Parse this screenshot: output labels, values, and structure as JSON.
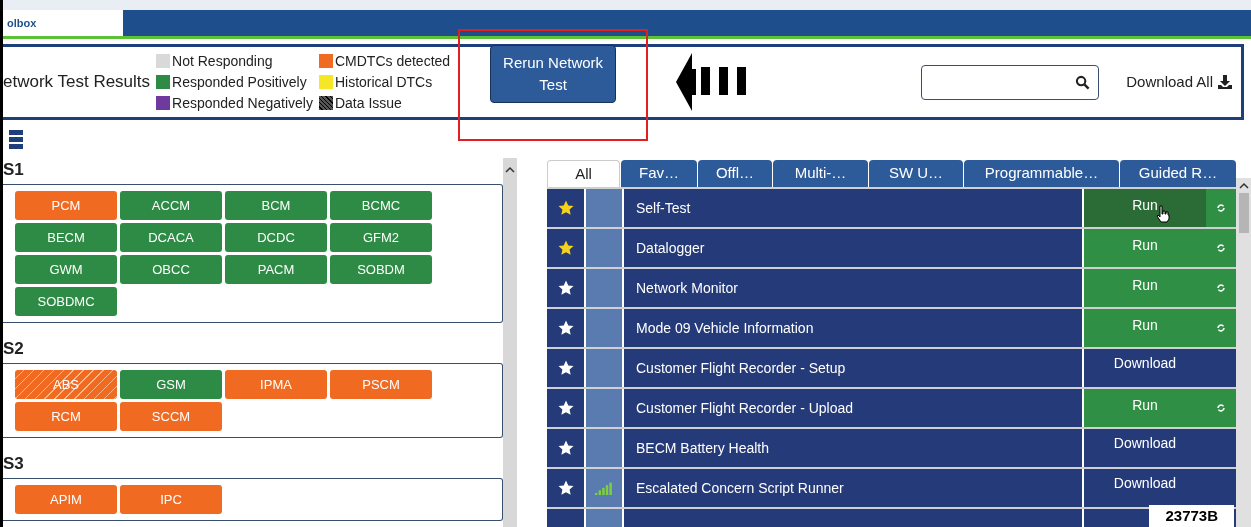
{
  "top_tab": {
    "label": "olbox",
    "selected": true
  },
  "header": {
    "title": "etwork Test Results",
    "legend": [
      {
        "label": "Not Responding",
        "color": "#d9d9d9",
        "hatched": false
      },
      {
        "label": "Responded Positively",
        "color": "#2e8b45",
        "hatched": false
      },
      {
        "label": "Responded Negatively",
        "color": "#6f3a9e",
        "hatched": false
      },
      {
        "label": "CMDTCs detected",
        "color": "#f06a22",
        "hatched": false
      },
      {
        "label": "Historical DTCs",
        "color": "#f5e626",
        "hatched": false
      },
      {
        "label": "Data Issue",
        "color": "#555555",
        "hatched": true
      }
    ],
    "rerun_button": "Rerun Network Test",
    "download_all": "Download All"
  },
  "networks": [
    {
      "name": "S1",
      "modules": [
        {
          "label": "PCM",
          "color": "#f06a22",
          "hatched": false
        },
        {
          "label": "ACCM",
          "color": "#2e8b45",
          "hatched": false
        },
        {
          "label": "BCM",
          "color": "#2e8b45",
          "hatched": false
        },
        {
          "label": "BCMC",
          "color": "#2e8b45",
          "hatched": false
        },
        {
          "label": "BECM",
          "color": "#2e8b45",
          "hatched": false
        },
        {
          "label": "DCACA",
          "color": "#2e8b45",
          "hatched": false
        },
        {
          "label": "DCDC",
          "color": "#2e8b45",
          "hatched": false
        },
        {
          "label": "GFM2",
          "color": "#2e8b45",
          "hatched": false
        },
        {
          "label": "GWM",
          "color": "#2e8b45",
          "hatched": false
        },
        {
          "label": "OBCC",
          "color": "#2e8b45",
          "hatched": false
        },
        {
          "label": "PACM",
          "color": "#2e8b45",
          "hatched": false
        },
        {
          "label": "SOBDM",
          "color": "#2e8b45",
          "hatched": false
        },
        {
          "label": "SOBDMC",
          "color": "#2e8b45",
          "hatched": false
        }
      ]
    },
    {
      "name": "S2",
      "modules": [
        {
          "label": "ABS",
          "color": "#f06a22",
          "hatched": true
        },
        {
          "label": "GSM",
          "color": "#2e8b45",
          "hatched": false
        },
        {
          "label": "IPMA",
          "color": "#f06a22",
          "hatched": false
        },
        {
          "label": "PSCM",
          "color": "#f06a22",
          "hatched": false
        },
        {
          "label": "RCM",
          "color": "#f06a22",
          "hatched": false
        },
        {
          "label": "SCCM",
          "color": "#f06a22",
          "hatched": false
        }
      ]
    },
    {
      "name": "S3",
      "modules": [
        {
          "label": "APIM",
          "color": "#f06a22",
          "hatched": false
        },
        {
          "label": "IPC",
          "color": "#f06a22",
          "hatched": false
        }
      ]
    }
  ],
  "tool_tabs": [
    {
      "label": "All",
      "selected": true
    },
    {
      "label": "Fav…",
      "selected": false
    },
    {
      "label": "Offl…",
      "selected": false
    },
    {
      "label": "Multi-…",
      "selected": false
    },
    {
      "label": "SW U…",
      "selected": false
    },
    {
      "label": "Programmable…",
      "selected": false
    },
    {
      "label": "Guided R…",
      "selected": false
    }
  ],
  "tools": [
    {
      "name": "Self-Test",
      "favorite": true,
      "signal": false,
      "action": {
        "kind": "run",
        "label": "Run",
        "hovered": true
      }
    },
    {
      "name": "Datalogger",
      "favorite": true,
      "signal": false,
      "action": {
        "kind": "run",
        "label": "Run",
        "hovered": false
      }
    },
    {
      "name": "Network Monitor",
      "favorite": false,
      "signal": false,
      "action": {
        "kind": "run",
        "label": "Run",
        "hovered": false
      }
    },
    {
      "name": "Mode 09 Vehicle Information",
      "favorite": false,
      "signal": false,
      "action": {
        "kind": "run",
        "label": "Run",
        "hovered": false
      }
    },
    {
      "name": "Customer Flight Recorder - Setup",
      "favorite": false,
      "signal": false,
      "action": {
        "kind": "download",
        "label": "Download"
      }
    },
    {
      "name": "Customer Flight Recorder - Upload",
      "favorite": false,
      "signal": false,
      "action": {
        "kind": "run",
        "label": "Run",
        "hovered": false
      }
    },
    {
      "name": "BECM Battery Health",
      "favorite": false,
      "signal": false,
      "action": {
        "kind": "download",
        "label": "Download"
      }
    },
    {
      "name": "Escalated Concern Script Runner",
      "favorite": false,
      "signal": true,
      "action": {
        "kind": "download",
        "label": "Download"
      }
    }
  ],
  "figure_label": "23773B"
}
